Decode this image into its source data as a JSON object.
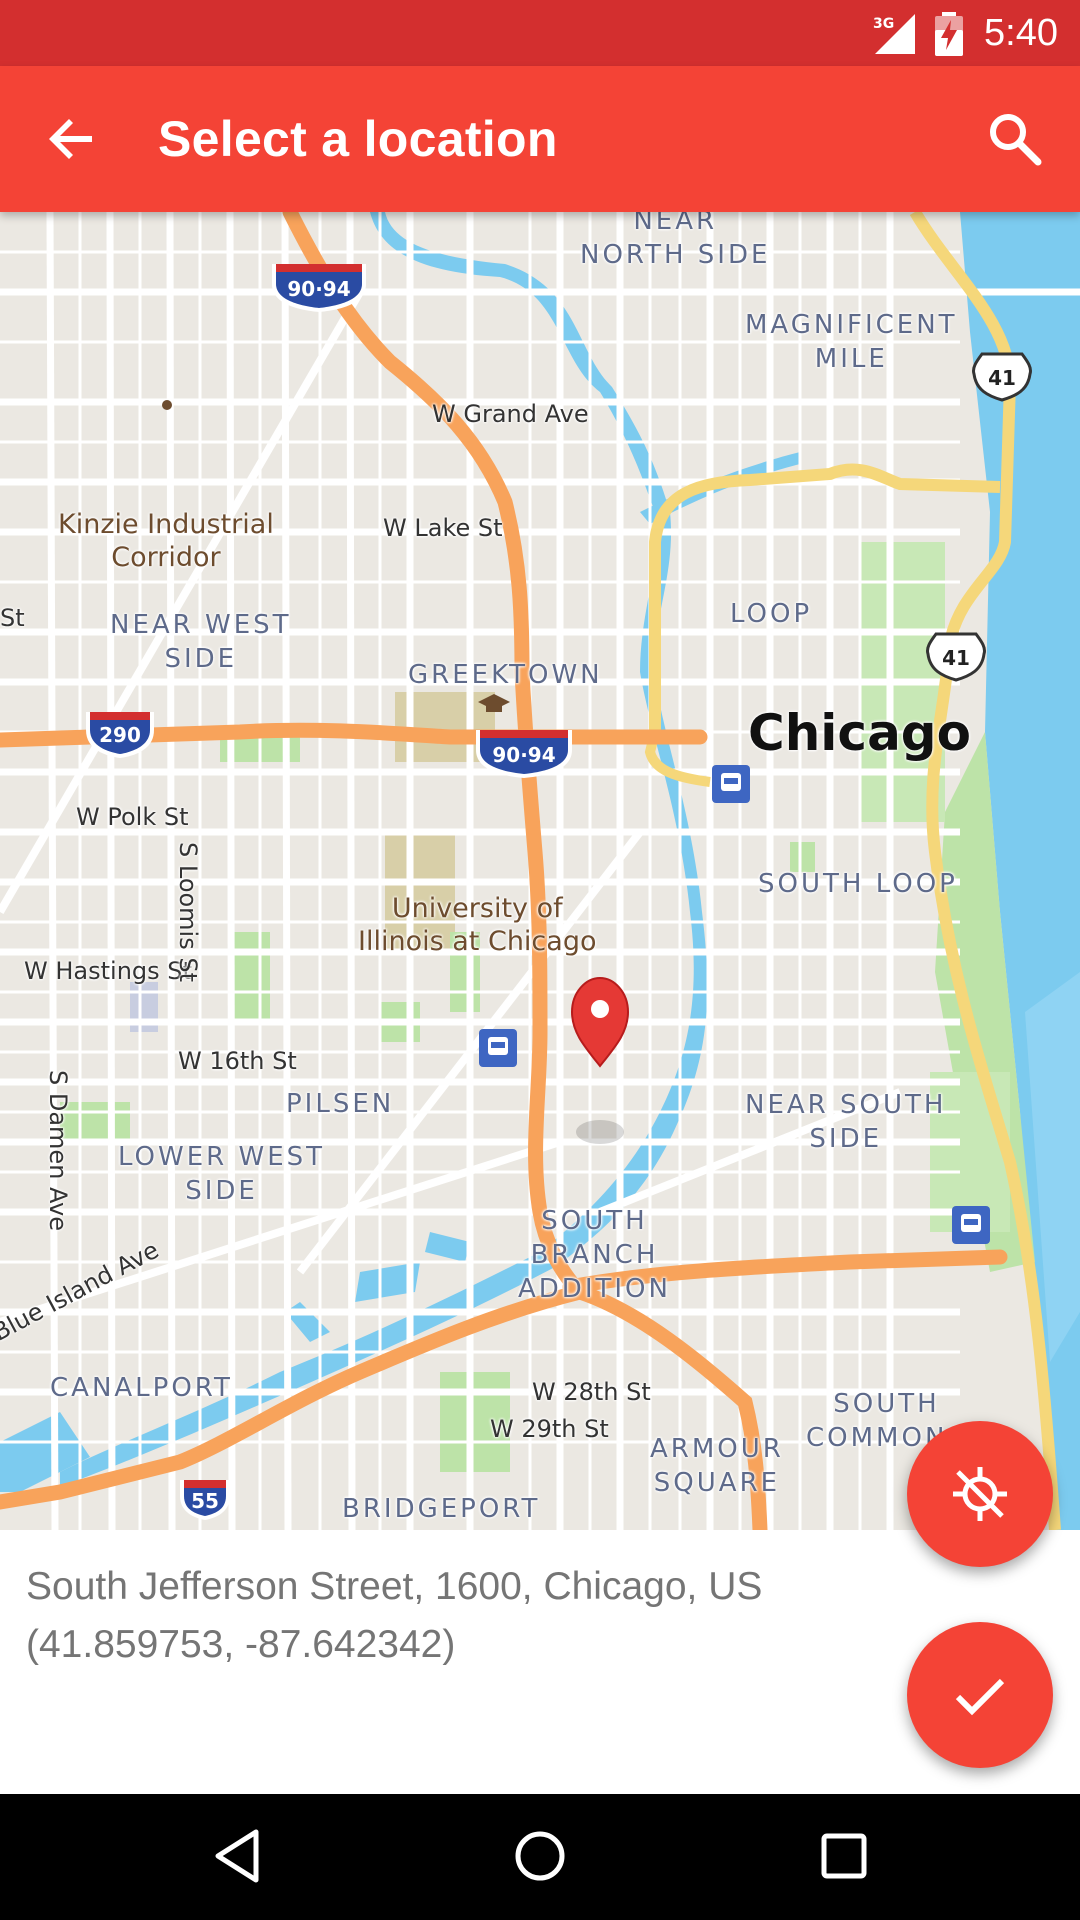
{
  "status_bar": {
    "time": "5:40",
    "network": "3G",
    "icons": [
      "signal-icon",
      "battery-charging-icon"
    ]
  },
  "app_bar": {
    "title": "Select a location",
    "back_icon": "arrow-back-icon",
    "search_icon": "search-icon",
    "color": "#f44336"
  },
  "map": {
    "city_label": "Chicago",
    "neighborhoods": {
      "near_north_side": "NEAR\nNORTH SIDE",
      "magnificent_mile": "MAGNIFICENT\nMILE",
      "near_west_side": "NEAR WEST\nSIDE",
      "greektown": "GREEKTOWN",
      "loop": "LOOP",
      "south_loop": "SOUTH LOOP",
      "pilsen": "PILSEN",
      "lower_west_side": "LOWER WEST\nSIDE",
      "near_south_side": "NEAR SOUTH\nSIDE",
      "south_branch_addition": "SOUTH\nBRANCH\nADDITION",
      "canalport": "CANALPORT",
      "bridgeport": "BRIDGEPORT",
      "armour_square": "ARMOUR\nSQUARE",
      "south_commons": "SOUTH\nCOMMONS"
    },
    "streets": {
      "w_grand_ave": "W Grand Ave",
      "w_lake_st": "W Lake St",
      "w_polk_st": "W Polk St",
      "s_loomis_st": "S Loomis St",
      "w_hastings_st": "W Hastings St",
      "w_16th_st": "W 16th St",
      "s_damen_ave": "S Damen Ave",
      "blue_island_ave": "Blue Island Ave",
      "w_28th_st": "W 28th St",
      "w_29th_st": "W 29th St",
      "st_partial": "St"
    },
    "pois": {
      "kinzie": "Kinzie Industrial\nCorridor",
      "uic": "University of\nIllinois at Chicago"
    },
    "highway_shields": {
      "i90_94_top": "90·94",
      "i90_94_mid": "90·94",
      "i290": "290",
      "i55": "55",
      "us41_top": "41",
      "us41_mid": "41"
    },
    "colors": {
      "land": "#ebe8e2",
      "water": "#7ccbef",
      "park": "#bde3a8",
      "highway": "#f8a35b",
      "arterial": "#f5d77a",
      "road": "#ffffff",
      "pin": "#e53935"
    }
  },
  "address": {
    "line1": "South Jefferson Street, 1600, Chicago, US",
    "line2": "(41.859753, -87.642342)"
  },
  "fabs": {
    "location": {
      "icon": "location-disabled-icon",
      "color": "#f44336"
    },
    "confirm": {
      "icon": "check-icon",
      "color": "#f44336"
    }
  },
  "nav_bar": {
    "icons": [
      "back-triangle-icon",
      "home-circle-icon",
      "recents-square-icon"
    ]
  }
}
